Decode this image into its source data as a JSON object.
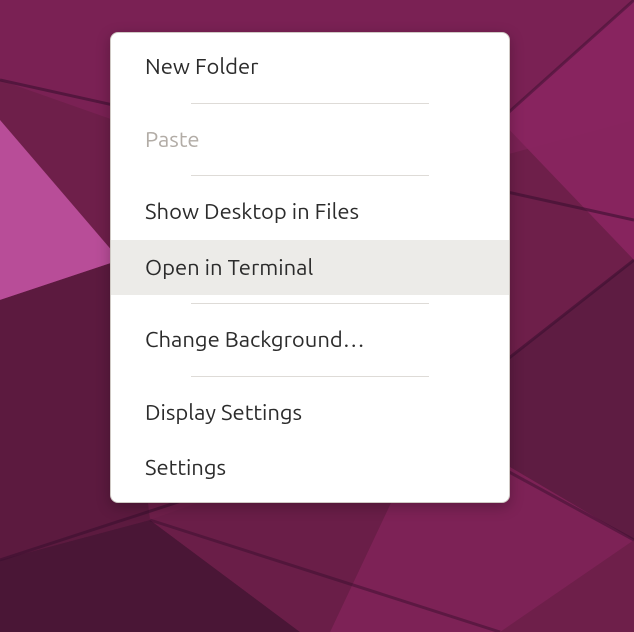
{
  "context_menu": {
    "items": [
      {
        "label": "New Folder",
        "enabled": true,
        "highlighted": false
      },
      {
        "separator": true
      },
      {
        "label": "Paste",
        "enabled": false,
        "highlighted": false
      },
      {
        "separator": true
      },
      {
        "label": "Show Desktop in Files",
        "enabled": true,
        "highlighted": false
      },
      {
        "label": "Open in Terminal",
        "enabled": true,
        "highlighted": true
      },
      {
        "separator": true
      },
      {
        "label": "Change Background…",
        "enabled": true,
        "highlighted": false
      },
      {
        "separator": true
      },
      {
        "label": "Display Settings",
        "enabled": true,
        "highlighted": false
      },
      {
        "label": "Settings",
        "enabled": true,
        "highlighted": false
      }
    ]
  },
  "wallpaper": {
    "base_colors": [
      "#6e1f4a",
      "#8a2560",
      "#5a1a3e",
      "#c556a6",
      "#3c1030"
    ]
  }
}
